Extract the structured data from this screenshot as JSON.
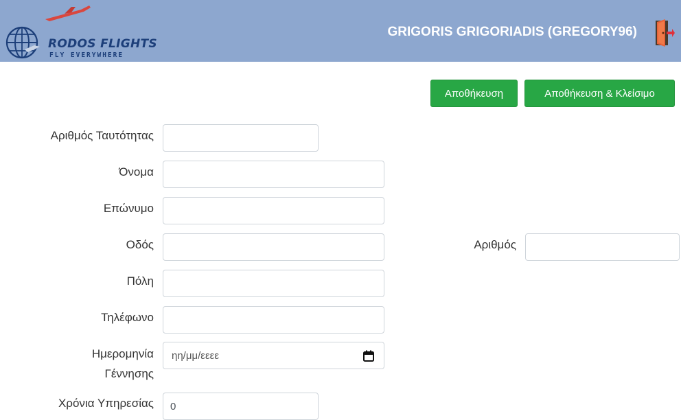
{
  "header": {
    "brand_name": "RODOS FLIGHTS",
    "brand_tagline": "FLY EVERYWHERE",
    "user_display": "GRIGORIS GRIGORIADIS (GREGORY96)",
    "logout_icon": "exit-door-icon",
    "background_color": "#8da7cf"
  },
  "toolbar": {
    "save_label": "Αποθήκευση",
    "save_close_label": "Αποθήκευση & Κλείσιμο",
    "button_color": "#28a745"
  },
  "form": {
    "id_number_label": "Αριθμός Ταυτότητας",
    "id_number_value": "",
    "first_name_label": "Όνομα",
    "first_name_value": "",
    "last_name_label": "Επώνυμο",
    "last_name_value": "",
    "street_label": "Οδός",
    "street_value": "",
    "street_number_label": "Αριθμός",
    "street_number_value": "",
    "city_label": "Πόλη",
    "city_value": "",
    "phone_label": "Τηλέφωνο",
    "phone_value": "",
    "birth_date_label_line1": "Ημερομηνία",
    "birth_date_label_line2": "Γέννησης",
    "birth_date_placeholder": "ηη/μμ/εεεε",
    "years_of_service_label": "Χρόνια Υπηρεσίας",
    "years_of_service_value": "0"
  }
}
